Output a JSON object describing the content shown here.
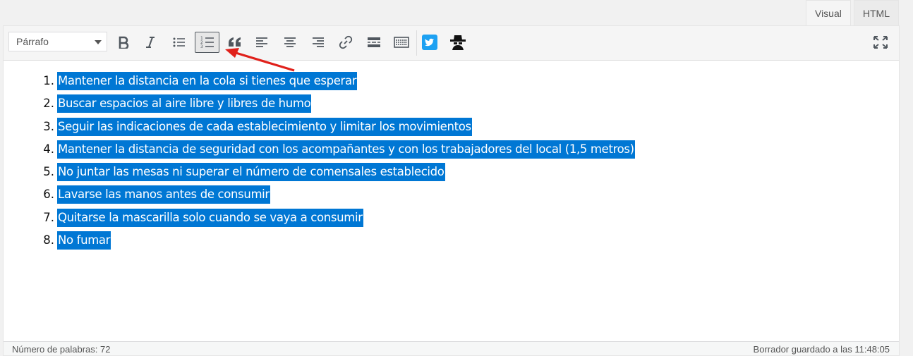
{
  "tabs": {
    "visual": "Visual",
    "html": "HTML"
  },
  "toolbar": {
    "format_select": "Párrafo",
    "buttons": [
      "bold",
      "italic",
      "bulleted-list",
      "numbered-list",
      "blockquote",
      "align-left",
      "align-center",
      "align-right",
      "insert-link",
      "read-more",
      "toolbar-toggle",
      "twitter",
      "spy"
    ],
    "active_button": "numbered-list"
  },
  "content": {
    "items": [
      {
        "num": "1.",
        "text": "Mantener la distancia en la cola si tienes que esperar"
      },
      {
        "num": "2.",
        "text": "Buscar espacios al aire libre y libres de humo"
      },
      {
        "num": "3.",
        "text": "Seguir las indicaciones de cada establecimiento y limitar los movimientos"
      },
      {
        "num": "4.",
        "text": "Mantener la distancia de seguridad con los acompañantes y con los trabajadores del local (1,5 metros)"
      },
      {
        "num": "5.",
        "text": "No juntar las mesas ni superar el número de comensales establecido"
      },
      {
        "num": "6.",
        "text": "Lavarse las manos antes de consumir"
      },
      {
        "num": "7.",
        "text": "Quitarse la mascarilla solo cuando se vaya a consumir"
      },
      {
        "num": "8.",
        "text": "No fumar"
      }
    ]
  },
  "status": {
    "word_count": "Número de palabras: 72",
    "draft_saved": "Borrador guardado a las 11:48:05"
  },
  "colors": {
    "selection": "#0077d4",
    "arrow": "#e0201a",
    "twitter": "#1da1f2"
  }
}
